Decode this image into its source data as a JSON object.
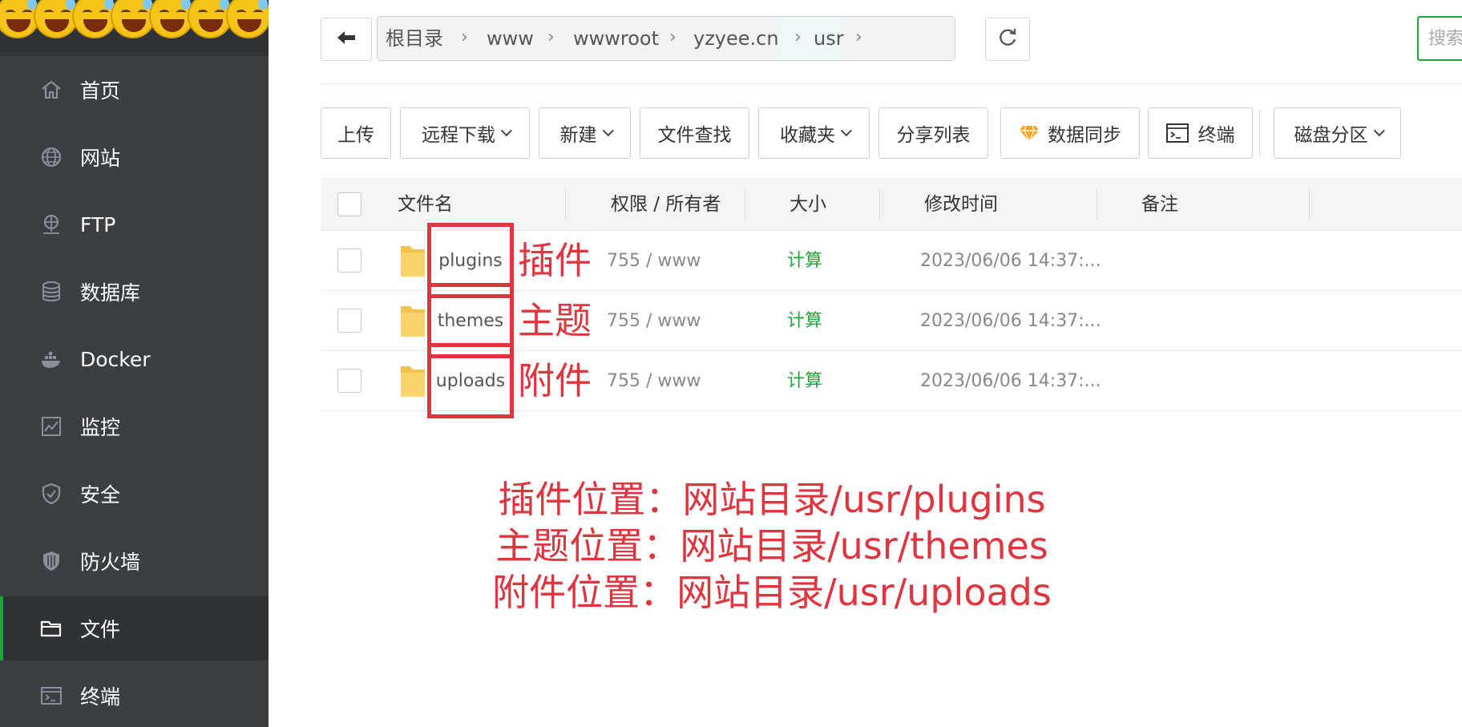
{
  "sidebar": {
    "items": [
      {
        "label": "首页",
        "icon": "home-icon"
      },
      {
        "label": "网站",
        "icon": "globe-icon"
      },
      {
        "label": "FTP",
        "icon": "ftp-icon"
      },
      {
        "label": "数据库",
        "icon": "database-icon"
      },
      {
        "label": "Docker",
        "icon": "docker-icon"
      },
      {
        "label": "监控",
        "icon": "monitor-icon"
      },
      {
        "label": "安全",
        "icon": "shield-icon"
      },
      {
        "label": "防火墙",
        "icon": "firewall-icon"
      },
      {
        "label": "文件",
        "icon": "folder-icon"
      },
      {
        "label": "终端",
        "icon": "terminal-icon"
      }
    ],
    "active_index": 8,
    "accent_color": "#20a53a"
  },
  "breadcrumb": {
    "items": [
      "根目录",
      "www",
      "wwwroot",
      "yzyee.cn",
      "usr"
    ]
  },
  "search": {
    "placeholder": "搜索"
  },
  "toolbar": {
    "upload": "上传",
    "remote_download": "远程下载",
    "new": "新建",
    "file_search": "文件查找",
    "favorites": "收藏夹",
    "share_list": "分享列表",
    "data_sync": "数据同步",
    "terminal": "终端",
    "disk_partition": "磁盘分区"
  },
  "table": {
    "headers": {
      "name": "文件名",
      "perm": "权限 / 所有者",
      "size": "大小",
      "mtime": "修改时间",
      "note": "备注"
    },
    "rows": [
      {
        "name": "plugins",
        "annotation": "插件",
        "perm": "755 / www",
        "size": "计算",
        "mtime": "2023/06/06 14:37:..."
      },
      {
        "name": "themes",
        "annotation": "主题",
        "perm": "755 / www",
        "size": "计算",
        "mtime": "2023/06/06 14:37:..."
      },
      {
        "name": "uploads",
        "annotation": "附件",
        "perm": "755 / www",
        "size": "计算",
        "mtime": "2023/06/06 14:37:..."
      }
    ]
  },
  "annotations": {
    "lines": [
      "插件位置：网站目录/usr/plugins",
      "主题位置：网站目录/usr/themes",
      "附件位置：网站目录/usr/uploads"
    ],
    "color": "#e0353f"
  }
}
